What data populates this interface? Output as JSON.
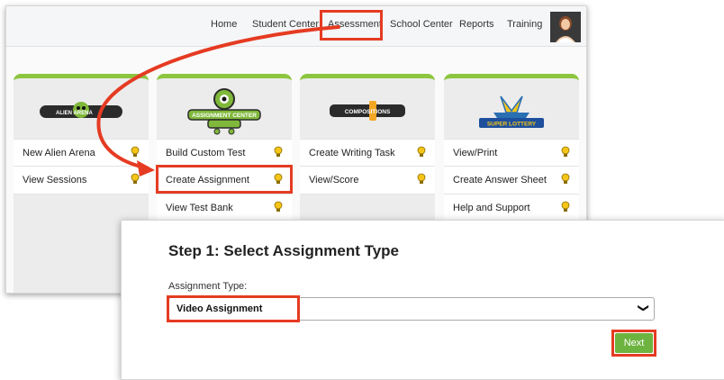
{
  "nav": {
    "items": [
      {
        "label": "Home"
      },
      {
        "label": "Student Center"
      },
      {
        "label": "Assessment"
      },
      {
        "label": "School Center"
      },
      {
        "label": "Reports"
      },
      {
        "label": "Training"
      }
    ],
    "avatar": "user-avatar"
  },
  "cards": [
    {
      "logo_text": "ALIEN ARENA",
      "items": [
        {
          "label": "New Alien Arena",
          "icon": "lightbulb-icon"
        },
        {
          "label": "View Sessions",
          "icon": "lightbulb-icon"
        }
      ]
    },
    {
      "logo_text": "ASSIGNMENT CENTER",
      "items": [
        {
          "label": "Build Custom Test",
          "icon": "lightbulb-icon"
        },
        {
          "label": "Create Assignment",
          "icon": "lightbulb-icon"
        },
        {
          "label": "View Test Bank",
          "icon": "lightbulb-icon"
        }
      ]
    },
    {
      "logo_text": "COMPOSITIONS",
      "items": [
        {
          "label": "Create Writing Task",
          "icon": "lightbulb-icon"
        },
        {
          "label": "View/Score",
          "icon": "lightbulb-icon"
        }
      ]
    },
    {
      "logo_text": "SUPER LOTTERY",
      "items": [
        {
          "label": "View/Print",
          "icon": "lightbulb-icon"
        },
        {
          "label": "Create Answer Sheet",
          "icon": "lightbulb-icon"
        },
        {
          "label": "Help and Support",
          "icon": "lightbulb-icon"
        }
      ]
    }
  ],
  "step": {
    "title": "Step 1: Select Assignment Type",
    "field_label": "Assignment Type:",
    "selected_value": "Video Assignment",
    "next_label": "Next"
  },
  "colors": {
    "highlight": "#e53b22",
    "accent_green": "#8cc63f",
    "button_green": "#6cb33f"
  }
}
